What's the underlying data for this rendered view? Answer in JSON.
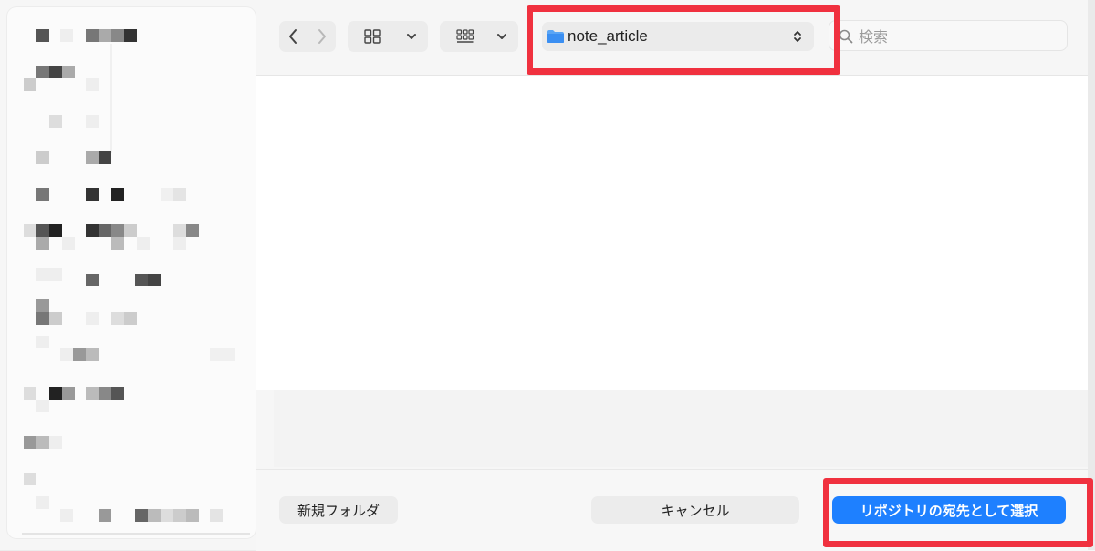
{
  "toolbar": {
    "back_icon": "chevron-left-icon",
    "forward_icon": "chevron-right-icon",
    "view_icon": "grid-view-icon",
    "group_icon": "group-by-icon",
    "location": {
      "label": "note_article",
      "icon": "folder-icon",
      "folder_color": "#3b8ff2"
    },
    "search": {
      "placeholder": "検索",
      "value": ""
    }
  },
  "buttons": {
    "new_folder": "新規フォルダ",
    "cancel": "キャンセル",
    "select": "リポジトリの宛先として選択"
  },
  "colors": {
    "accent": "#1e80ff",
    "annotation": "#f0313f"
  }
}
